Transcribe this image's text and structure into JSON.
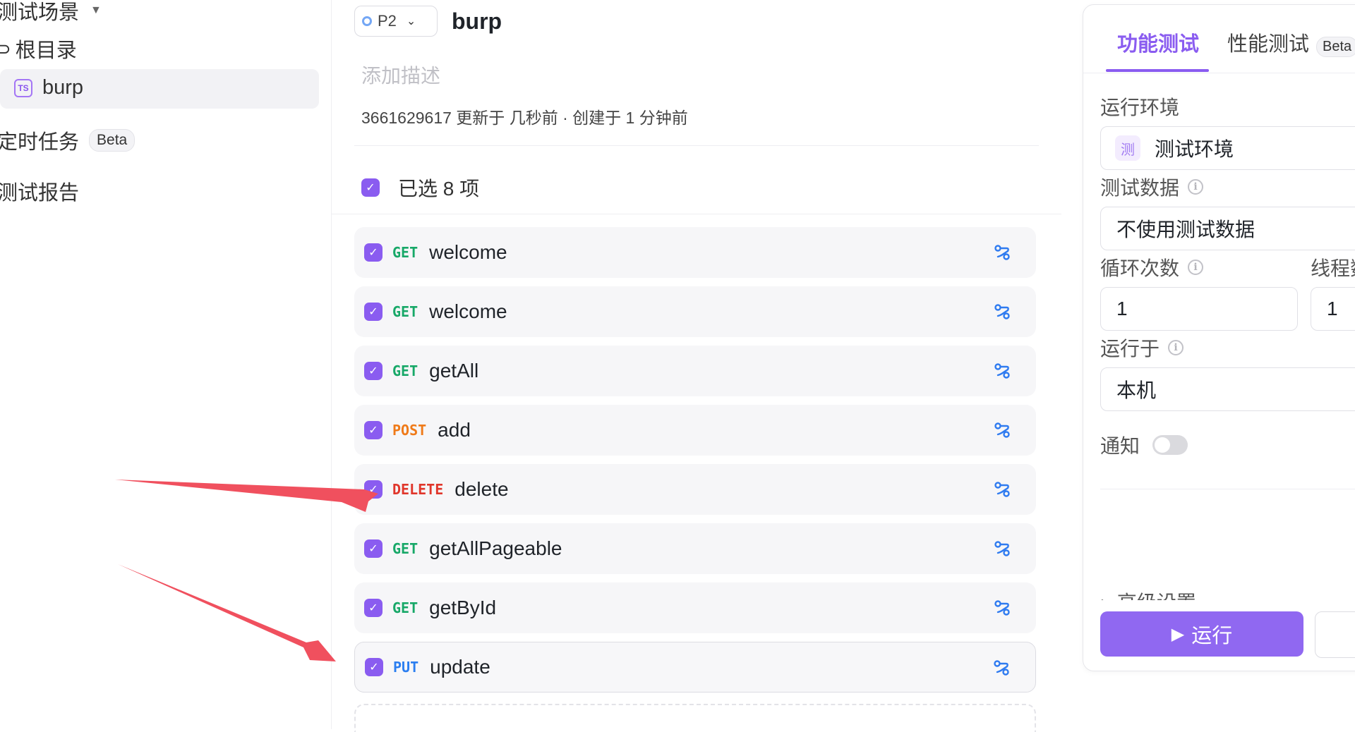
{
  "sidebar": {
    "scenarios_label": "测试场景",
    "root_label": "根目录",
    "selected_item": "burp",
    "ts_badge": "TS",
    "scheduled_tasks": "定时任务",
    "scheduled_beta": "Beta",
    "reports": "测试报告"
  },
  "header": {
    "priority": "P2",
    "title": "burp",
    "description_placeholder": "添加描述",
    "meta": "3661629617 更新于 几秒前 · 创建于 1 分钟前"
  },
  "selection": {
    "label": "已选 8 项"
  },
  "apis": [
    {
      "method": "GET",
      "name": "welcome"
    },
    {
      "method": "GET",
      "name": "welcome"
    },
    {
      "method": "GET",
      "name": "getAll"
    },
    {
      "method": "POST",
      "name": "add"
    },
    {
      "method": "DELETE",
      "name": "delete"
    },
    {
      "method": "GET",
      "name": "getAllPageable"
    },
    {
      "method": "GET",
      "name": "getById"
    },
    {
      "method": "PUT",
      "name": "update"
    }
  ],
  "method_colors": {
    "GET": "#17a868",
    "POST": "#ef7a19",
    "DELETE": "#e0362b",
    "PUT": "#2b7ef0"
  },
  "icons": {
    "checkbox": "check-icon",
    "api_action": "branch-link-icon",
    "info": "info-icon",
    "play": "play-icon"
  },
  "panel": {
    "tab_functional": "功能测试",
    "tab_performance": "性能测试",
    "tab_performance_beta": "Beta",
    "env_label": "运行环境",
    "env_badge": "测",
    "env_value": "测试环境",
    "data_label": "测试数据",
    "data_value": "不使用测试数据",
    "loop_label": "循环次数",
    "loop_value": "1",
    "threads_label": "线程数",
    "threads_value": "1",
    "runon_label": "运行于",
    "runon_value": "本机",
    "notify_label": "通知",
    "notify_on": false,
    "advanced_label": "高级设置",
    "run_button": "运行"
  },
  "colors": {
    "accent": "#8a5cf0",
    "annotation_arrow": "#f0505e"
  }
}
